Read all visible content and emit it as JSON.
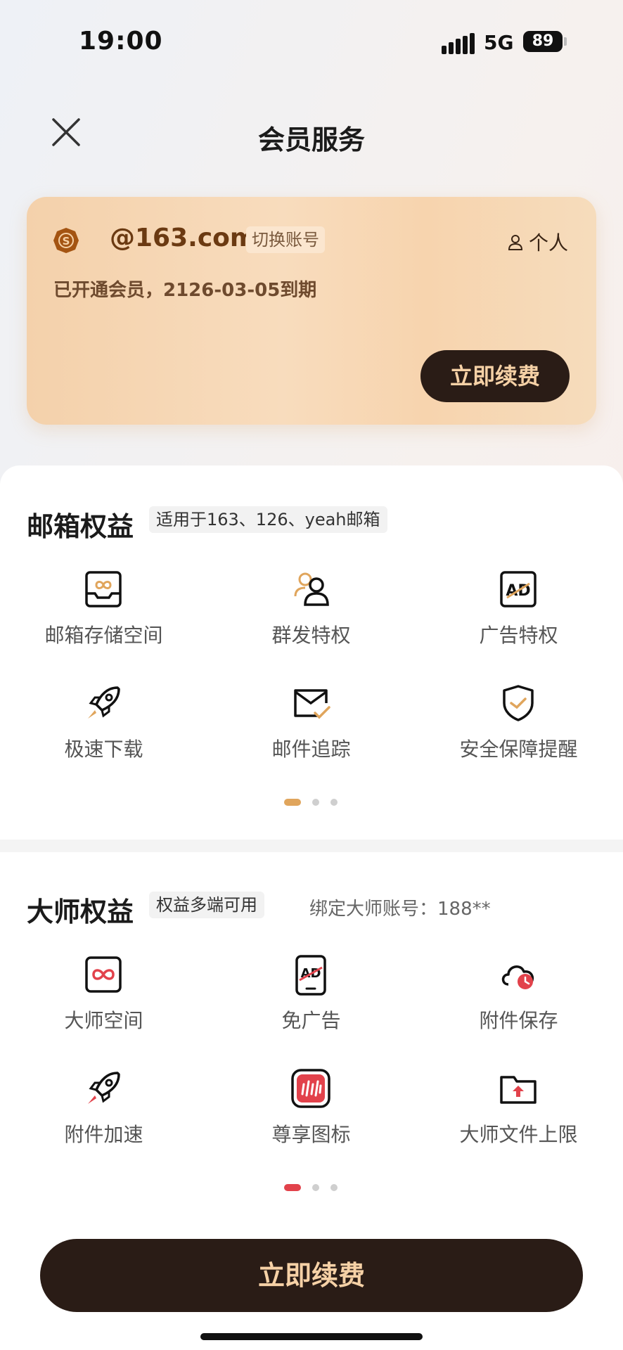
{
  "status_bar": {
    "time": "19:00",
    "network": "5G",
    "battery": "89"
  },
  "header": {
    "title": "会员服务"
  },
  "member_card": {
    "email": "@163.com",
    "switch_label": "切换账号",
    "personal_label": "个人",
    "status": "已开通会员，2126-03-05到期",
    "renew_label": "立即续费"
  },
  "mail_section": {
    "title": "邮箱权益",
    "tag": "适用于163、126、yeah邮箱",
    "items": [
      {
        "label": "邮箱存储空间",
        "icon": "mailbox-storage-icon"
      },
      {
        "label": "群发特权",
        "icon": "group-send-icon"
      },
      {
        "label": "广告特权",
        "icon": "ad-icon"
      },
      {
        "label": "极速下载",
        "icon": "rocket-icon"
      },
      {
        "label": "邮件追踪",
        "icon": "mail-check-icon"
      },
      {
        "label": "安全保障提醒",
        "icon": "shield-check-icon"
      }
    ],
    "page_index": 0,
    "accent": "#e0a55c"
  },
  "master_section": {
    "title": "大师权益",
    "tag": "权益多端可用",
    "bound_account": "绑定大师账号：188**",
    "items": [
      {
        "label": "大师空间",
        "icon": "master-space-icon"
      },
      {
        "label": "免广告",
        "icon": "no-ad-icon"
      },
      {
        "label": "附件保存",
        "icon": "cloud-clock-icon"
      },
      {
        "label": "附件加速",
        "icon": "rocket-red-icon"
      },
      {
        "label": "尊享图标",
        "icon": "exclusive-app-icon"
      },
      {
        "label": "大师文件上限",
        "icon": "folder-upload-icon"
      }
    ],
    "page_index": 0,
    "accent": "#e2424b"
  },
  "bottom": {
    "renew_label": "立即续费"
  },
  "colors": {
    "dark_button": "#2a1c16",
    "button_text": "#f6d1a6",
    "card_gold": "#f6d6b3"
  }
}
